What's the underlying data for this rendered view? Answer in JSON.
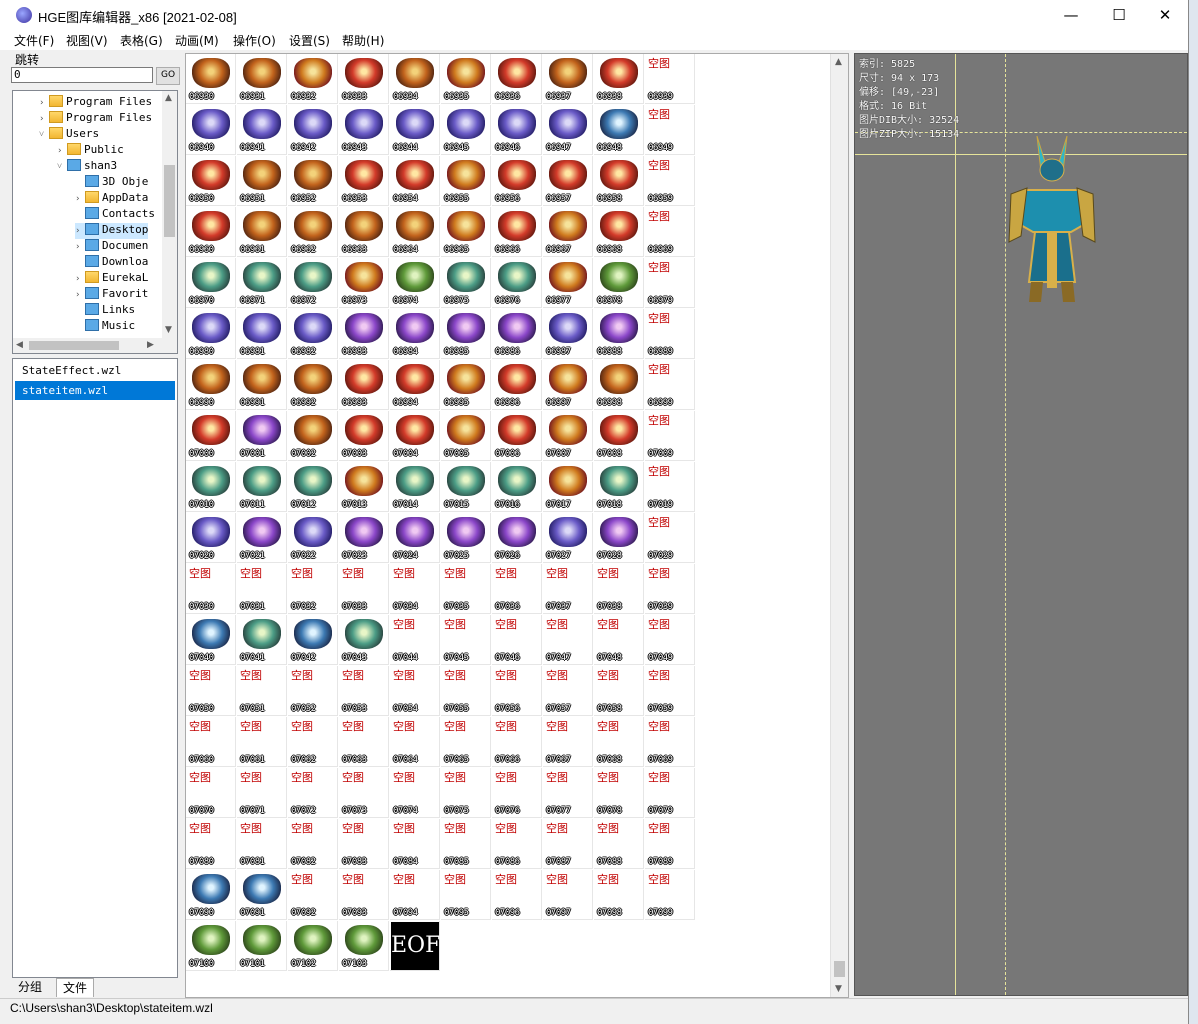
{
  "window": {
    "title": "HGE图库编辑器_x86 [2021-02-08]",
    "minimize": "—",
    "maximize": "☐",
    "close": "✕"
  },
  "menu": [
    "文件(F)",
    "视图(V)",
    "表格(G)",
    "动画(M)",
    "操作(O)",
    "设置(S)",
    "帮助(H)"
  ],
  "jump": {
    "label": "跳转",
    "value": "0",
    "go": "GO"
  },
  "tree": [
    {
      "label": "Program Files",
      "depth": 3,
      "arrow": "›",
      "icon": "folder-icon"
    },
    {
      "label": "Program Files",
      "depth": 3,
      "arrow": "›",
      "icon": "folder-icon"
    },
    {
      "label": "Users",
      "depth": 3,
      "arrow": "˅",
      "icon": "folder-icon"
    },
    {
      "label": "Public",
      "depth": 4,
      "arrow": "›",
      "icon": "folder-icon"
    },
    {
      "label": "shan3",
      "depth": 4,
      "arrow": "˅",
      "icon": "user-icon"
    },
    {
      "label": "3D Obje",
      "depth": 5,
      "arrow": "",
      "icon": "3d-objects-icon"
    },
    {
      "label": "AppData",
      "depth": 5,
      "arrow": "›",
      "icon": "folder-icon"
    },
    {
      "label": "Contacts",
      "depth": 5,
      "arrow": "",
      "icon": "contacts-icon"
    },
    {
      "label": "Desktop",
      "depth": 5,
      "arrow": "›",
      "icon": "desktop-icon",
      "selected": true
    },
    {
      "label": "Documen",
      "depth": 5,
      "arrow": "›",
      "icon": "documents-icon"
    },
    {
      "label": "Downloa",
      "depth": 5,
      "arrow": "",
      "icon": "downloads-icon"
    },
    {
      "label": "EurekaL",
      "depth": 5,
      "arrow": "›",
      "icon": "folder-icon"
    },
    {
      "label": "Favorit",
      "depth": 5,
      "arrow": "›",
      "icon": "favorites-icon"
    },
    {
      "label": "Links",
      "depth": 5,
      "arrow": "",
      "icon": "links-icon"
    },
    {
      "label": "Music",
      "depth": 5,
      "arrow": "",
      "icon": "music-icon"
    }
  ],
  "files": [
    {
      "name": "StateEffect.wzl",
      "selected": false
    },
    {
      "name": "stateitem.wzl",
      "selected": true
    }
  ],
  "tabs": [
    "分组",
    "文件"
  ],
  "grid": {
    "empty_label": "空图",
    "eof_label": "EOF",
    "rows": [
      {
        "start": "06930",
        "cells": [
          "s0",
          "s0",
          "s2",
          "s5",
          "s0",
          "s2",
          "s5",
          "s0",
          "s5",
          "e"
        ]
      },
      {
        "start": "06940",
        "cells": [
          "s1",
          "s1",
          "s1",
          "s1",
          "s1",
          "s1",
          "s1",
          "s1",
          "s6",
          "e"
        ]
      },
      {
        "start": "06950",
        "cells": [
          "s5",
          "s0",
          "s0",
          "s5",
          "s5",
          "s2",
          "s5",
          "s5",
          "s5",
          "e"
        ]
      },
      {
        "start": "06960",
        "cells": [
          "s5",
          "s0",
          "s0",
          "s0",
          "s0",
          "s2",
          "s5",
          "s2",
          "s5",
          "e"
        ]
      },
      {
        "start": "06970",
        "cells": [
          "s3",
          "s3",
          "s3",
          "s2",
          "s7",
          "s3",
          "s3",
          "s2",
          "s7",
          "e"
        ]
      },
      {
        "start": "06980",
        "cells": [
          "s1",
          "s1",
          "s1",
          "s4",
          "s4",
          "s4",
          "s4",
          "s1",
          "s4",
          "e"
        ]
      },
      {
        "start": "06990",
        "cells": [
          "s0",
          "s0",
          "s0",
          "s5",
          "s5",
          "s2",
          "s5",
          "s2",
          "s0",
          "e"
        ]
      },
      {
        "start": "07000",
        "cells": [
          "s5",
          "s4",
          "s0",
          "s5",
          "s5",
          "s2",
          "s5",
          "s2",
          "s5",
          "e"
        ]
      },
      {
        "start": "07010",
        "cells": [
          "s3",
          "s3",
          "s3",
          "s2",
          "s3",
          "s3",
          "s3",
          "s2",
          "s3",
          "e"
        ]
      },
      {
        "start": "07020",
        "cells": [
          "s1",
          "s4",
          "s1",
          "s4",
          "s4",
          "s4",
          "s4",
          "s1",
          "s4",
          "e"
        ]
      },
      {
        "start": "07030",
        "cells": [
          "e",
          "e",
          "e",
          "e",
          "e",
          "e",
          "e",
          "e",
          "e",
          "e"
        ]
      },
      {
        "start": "07040",
        "cells": [
          "s6",
          "s3",
          "s6",
          "s3",
          "e",
          "e",
          "e",
          "e",
          "e",
          "e"
        ]
      },
      {
        "start": "07050",
        "cells": [
          "e",
          "e",
          "e",
          "e",
          "e",
          "e",
          "e",
          "e",
          "e",
          "e"
        ]
      },
      {
        "start": "07060",
        "cells": [
          "e",
          "e",
          "e",
          "e",
          "e",
          "e",
          "e",
          "e",
          "e",
          "e"
        ]
      },
      {
        "start": "07070",
        "cells": [
          "e",
          "e",
          "e",
          "e",
          "e",
          "e",
          "e",
          "e",
          "e",
          "e"
        ]
      },
      {
        "start": "07080",
        "cells": [
          "e",
          "e",
          "e",
          "e",
          "e",
          "e",
          "e",
          "e",
          "e",
          "e"
        ]
      },
      {
        "start": "07090",
        "cells": [
          "s6",
          "s6",
          "e",
          "e",
          "e",
          "e",
          "e",
          "e",
          "e",
          "e"
        ]
      },
      {
        "start": "07100",
        "cells": [
          "s7",
          "s7",
          "s7",
          "s7",
          "eof"
        ]
      }
    ]
  },
  "preview": {
    "info": [
      "索引: 5825",
      "尺寸: 94 x 173",
      "偏移: [49,-23]",
      "格式: 16 Bit",
      "图片DIB大小: 32524",
      "图片ZIP大小: 15134"
    ]
  },
  "status": "C:\\Users\\shan3\\Desktop\\stateitem.wzl",
  "colors": {
    "selection": "#0078d7",
    "preview_bg": "#777777",
    "guide": "#e6e49a",
    "empty_text": "#c00000"
  }
}
